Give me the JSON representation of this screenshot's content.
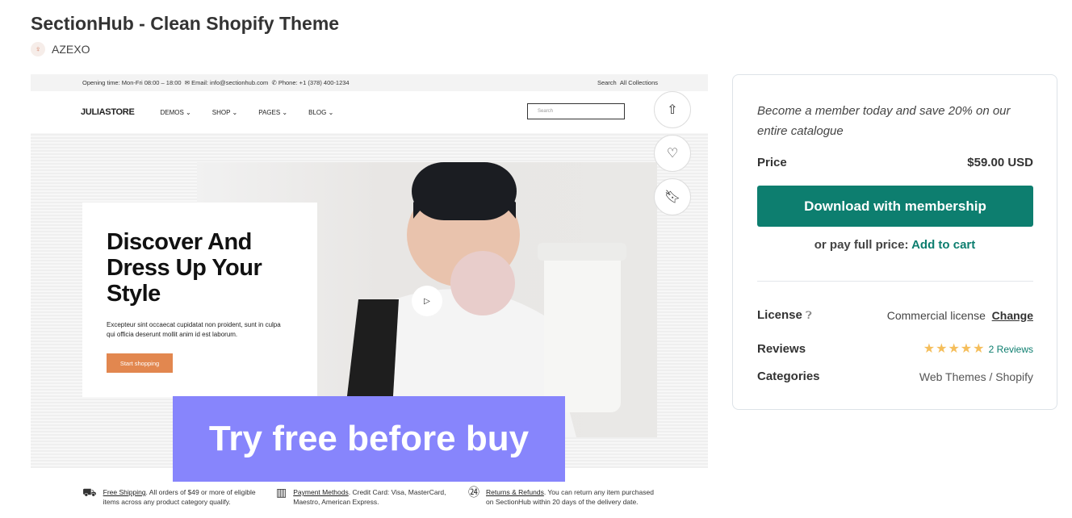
{
  "title": "SectionHub - Clean Shopify Theme",
  "author": "AZEXO",
  "preview": {
    "topbar": {
      "opening": "Opening time: Mon-Fri 08:00 – 18:00",
      "email": "Email: info@sectionhub.com",
      "phone": "Phone: +1 (378) 400-1234",
      "search": "Search",
      "collections": "All Collections"
    },
    "logo": "JULIASTORE",
    "menu": [
      "DEMOS ⌄",
      "SHOP ⌄",
      "PAGES ⌄",
      "BLOG ⌄"
    ],
    "search_placeholder": "Search",
    "hero": {
      "heading": "Discover And Dress Up Your Style",
      "text": "Excepteur sint occaecat cupidatat non proident, sunt in culpa qui officia deserunt mollit anim id est laborum.",
      "button": "Start shopping"
    },
    "banner": "Try free before buy",
    "features": [
      {
        "link": "Free Shipping",
        "text": ". All orders of $49 or more of eligible items across any product category qualify."
      },
      {
        "link": "Payment Methods",
        "text": ". Credit Card: Visa, MasterCard, Maestro, American Express."
      },
      {
        "link": "Returns & Refunds",
        "text": ". You can return any item purchased on SectionHub within 20 days of the delivery date."
      }
    ]
  },
  "panel": {
    "promo": "Become a member today and save 20% on our entire catalogue",
    "price_label": "Price",
    "price": "$59.00 USD",
    "download": "Download with membership",
    "or_text": "or pay full price:",
    "add_to_cart": "Add to cart",
    "license_label": "License",
    "license": "Commercial license",
    "change": "Change",
    "reviews_label": "Reviews",
    "rating": 5,
    "reviews": "2 Reviews",
    "categories_label": "Categories",
    "categories": "Web Themes / Shopify"
  },
  "colors": {
    "accent": "#0d7e6f",
    "banner": "#8785fc",
    "star": "#f5be5b",
    "cta": "#e2874f"
  }
}
